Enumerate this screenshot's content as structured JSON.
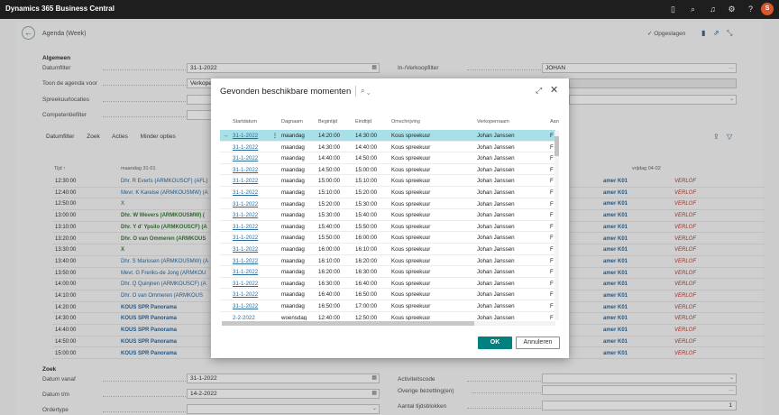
{
  "app": {
    "title": "Dynamics 365 Business Central",
    "avatar": "S"
  },
  "page": {
    "title": "Agenda (Week)",
    "saved_label": "✓ Opgeslagen"
  },
  "general": {
    "heading": "Algemeen",
    "datumfilter_label": "Datumfilter",
    "datumfilter_value": "31-1-2022",
    "toon_label": "Toon de agenda voor",
    "toon_value": "Verkope",
    "spreekuur_label": "Spreekuurlocaties",
    "competentie_label": "Competentiefilter",
    "inverkoop_label": "In-/Verkoopfilter",
    "inverkoop_value": "JOHAN"
  },
  "toolbar": {
    "datumfilter": "Datumfilter",
    "zoek": "Zoek",
    "acties": "Acties",
    "minder": "Minder opties"
  },
  "bg_grid": {
    "col_tijd": "Tijd ↑",
    "col_maandag": "maandag 31-01",
    "col_vrijdag": "vrijdag 04-02",
    "rows": [
      {
        "t": "12:30:00",
        "d": "Dhr. R Everts (ARMKOUSCF) (AFL)",
        "s": "link",
        "k": "amer K01",
        "v": "VERLOF"
      },
      {
        "t": "12:40:00",
        "d": "Mevr. K Kareise (ARMKOUSMW) (A",
        "s": "link",
        "k": "amer K01",
        "v": "VERLOF"
      },
      {
        "t": "12:50:00",
        "d": "X",
        "s": "plain",
        "k": "amer K01",
        "v": "VERLOF"
      },
      {
        "t": "13:00:00",
        "d": "Dhr. W Wevers (ARMKOUSMW) (",
        "s": "bold",
        "k": "amer K01",
        "v": "VERLOF"
      },
      {
        "t": "13:10:00",
        "d": "Dhr. Y d' Ypsilo (ARMKOUSCF) (A",
        "s": "bold",
        "k": "amer K01",
        "v": "VERLOF"
      },
      {
        "t": "13:20:00",
        "d": "Dhr. O van Ommeren (ARMKOUS",
        "s": "bold",
        "k": "amer K01",
        "v": "VERLOF"
      },
      {
        "t": "13:30:00",
        "d": "X",
        "s": "bold",
        "k": "amer K01",
        "v": "VERLOF"
      },
      {
        "t": "13:40:00",
        "d": "Dhr. S Marissen (ARMKOUSMW) (A",
        "s": "link",
        "k": "amer K01",
        "v": "VERLOF"
      },
      {
        "t": "13:50:00",
        "d": "Mevr. G Freriks-de Jong (ARMKOU",
        "s": "link",
        "k": "amer K01",
        "v": "VERLOF"
      },
      {
        "t": "14:00:00",
        "d": "Dhr. Q Quinjnen (ARMKOUSCF) (A",
        "s": "link",
        "k": "amer K01",
        "v": "VERLOF"
      },
      {
        "t": "14:10:00",
        "d": "Dhr. O van Ommeren (ARMKOUS",
        "s": "link",
        "k": "amer K01",
        "v": "VERLOF"
      },
      {
        "t": "14:20:00",
        "d": "KOUS SPR Panorama",
        "s": "linkbold",
        "k": "amer K01",
        "v": "VERLOF"
      },
      {
        "t": "14:30:00",
        "d": "KOUS SPR Panorama",
        "s": "linkbold",
        "k": "amer K01",
        "v": "VERLOF"
      },
      {
        "t": "14:40:00",
        "d": "KOUS SPR Panorama",
        "s": "linkbold",
        "k": "amer K01",
        "v": "VERLOF"
      },
      {
        "t": "14:50:00",
        "d": "KOUS SPR Panorama",
        "s": "linkbold",
        "k": "amer K01",
        "v": "VERLOF"
      },
      {
        "t": "15:00:00",
        "d": "KOUS SPR Panorama",
        "s": "linkbold",
        "k": "amer K01",
        "v": "VERLOF"
      }
    ]
  },
  "search_section": {
    "heading": "Zoek",
    "datum_vanaf_label": "Datum vanaf",
    "datum_vanaf_value": "31-1-2022",
    "datum_tm_label": "Datum t/m",
    "datum_tm_value": "14-2-2022",
    "ordertype_label": "Ordertype",
    "activiteit_label": "Activiteitscode",
    "overige_label": "Overige bezetting(en)",
    "aantal_label": "Aantal tijdsblokken",
    "aantal_value": "1"
  },
  "dialog": {
    "title": "Gevonden beschikbare momenten",
    "columns": {
      "startdatum": "Startdatum",
      "dagnaam": "Dagnaam",
      "begintijd": "Begintijd",
      "eindtijd": "Eindtijd",
      "omschrijving": "Omschrijving",
      "verkoper": "Verkopernaam",
      "aan": "Aan"
    },
    "rows": [
      {
        "date": "31-1-2022",
        "day": "maandag",
        "start": "14:20:00",
        "end": "14:30:00",
        "desc": "Kous spreekuur",
        "seller": "Johan Janssen",
        "aan": "F"
      },
      {
        "date": "31-1-2022",
        "day": "maandag",
        "start": "14:30:00",
        "end": "14:40:00",
        "desc": "Kous spreekuur",
        "seller": "Johan Janssen",
        "aan": "F"
      },
      {
        "date": "31-1-2022",
        "day": "maandag",
        "start": "14:40:00",
        "end": "14:50:00",
        "desc": "Kous spreekuur",
        "seller": "Johan Janssen",
        "aan": "F"
      },
      {
        "date": "31-1-2022",
        "day": "maandag",
        "start": "14:50:00",
        "end": "15:00:00",
        "desc": "Kous spreekuur",
        "seller": "Johan Janssen",
        "aan": "F"
      },
      {
        "date": "31-1-2022",
        "day": "maandag",
        "start": "15:00:00",
        "end": "15:10:00",
        "desc": "Kous spreekuur",
        "seller": "Johan Janssen",
        "aan": "F"
      },
      {
        "date": "31-1-2022",
        "day": "maandag",
        "start": "15:10:00",
        "end": "15:20:00",
        "desc": "Kous spreekuur",
        "seller": "Johan Janssen",
        "aan": "F"
      },
      {
        "date": "31-1-2022",
        "day": "maandag",
        "start": "15:20:00",
        "end": "15:30:00",
        "desc": "Kous spreekuur",
        "seller": "Johan Janssen",
        "aan": "F"
      },
      {
        "date": "31-1-2022",
        "day": "maandag",
        "start": "15:30:00",
        "end": "15:40:00",
        "desc": "Kous spreekuur",
        "seller": "Johan Janssen",
        "aan": "F"
      },
      {
        "date": "31-1-2022",
        "day": "maandag",
        "start": "15:40:00",
        "end": "15:50:00",
        "desc": "Kous spreekuur",
        "seller": "Johan Janssen",
        "aan": "F"
      },
      {
        "date": "31-1-2022",
        "day": "maandag",
        "start": "15:50:00",
        "end": "16:00:00",
        "desc": "Kous spreekuur",
        "seller": "Johan Janssen",
        "aan": "F"
      },
      {
        "date": "31-1-2022",
        "day": "maandag",
        "start": "16:00:00",
        "end": "16:10:00",
        "desc": "Kous spreekuur",
        "seller": "Johan Janssen",
        "aan": "F"
      },
      {
        "date": "31-1-2022",
        "day": "maandag",
        "start": "16:10:00",
        "end": "16:20:00",
        "desc": "Kous spreekuur",
        "seller": "Johan Janssen",
        "aan": "F"
      },
      {
        "date": "31-1-2022",
        "day": "maandag",
        "start": "16:20:00",
        "end": "16:30:00",
        "desc": "Kous spreekuur",
        "seller": "Johan Janssen",
        "aan": "F"
      },
      {
        "date": "31-1-2022",
        "day": "maandag",
        "start": "16:30:00",
        "end": "16:40:00",
        "desc": "Kous spreekuur",
        "seller": "Johan Janssen",
        "aan": "F"
      },
      {
        "date": "31-1-2022",
        "day": "maandag",
        "start": "16:40:00",
        "end": "16:50:00",
        "desc": "Kous spreekuur",
        "seller": "Johan Janssen",
        "aan": "F"
      },
      {
        "date": "31-1-2022",
        "day": "maandag",
        "start": "16:50:00",
        "end": "17:00:00",
        "desc": "Kous spreekuur",
        "seller": "Johan Janssen",
        "aan": "F"
      },
      {
        "date": "2-2-2022",
        "day": "woensdag",
        "start": "12:40:00",
        "end": "12:50:00",
        "desc": "Kous spreekuur",
        "seller": "Johan Janssen",
        "aan": "F"
      }
    ],
    "ok_label": "OK",
    "cancel_label": "Annuleren"
  },
  "colors": {
    "selected_row": "#a7e0e8",
    "ok_button": "#00807f",
    "link": "#2a6b9b",
    "verlof": "#c0392b"
  }
}
